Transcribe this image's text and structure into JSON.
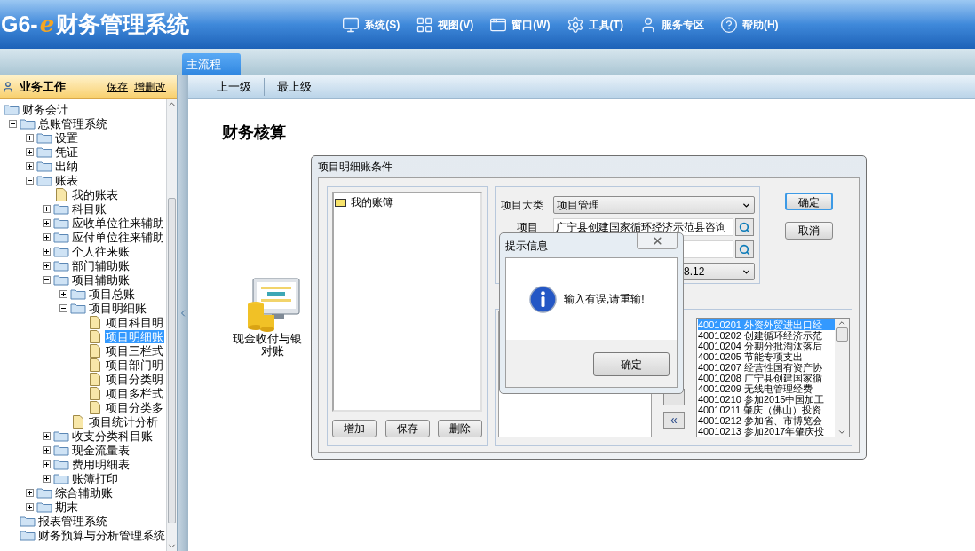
{
  "app": {
    "logo_prefix": "G6-",
    "logo_e": "e",
    "logo_title": "财务管理系统"
  },
  "menu": [
    {
      "kind": "monitor",
      "label": "系统(S)"
    },
    {
      "kind": "grid",
      "label": "视图(V)"
    },
    {
      "kind": "window",
      "label": "窗口(W)"
    },
    {
      "kind": "gear",
      "label": "工具(T)"
    },
    {
      "kind": "user",
      "label": "服务专区"
    },
    {
      "kind": "help",
      "label": "帮助(H)"
    }
  ],
  "tabs": [
    {
      "label": "主流程",
      "selected": true
    }
  ],
  "sidebar": {
    "title": "业务工作",
    "links": [
      "保存",
      "增删改"
    ],
    "tree": [
      {
        "label": "财务会计",
        "kind": "folder",
        "selected": false,
        "children": [
          {
            "label": "总账管理系统",
            "kind": "folder",
            "expanded": true,
            "selected": false,
            "children": [
              {
                "label": "设置",
                "kind": "folder",
                "expanded": false,
                "selected": false
              },
              {
                "label": "凭证",
                "kind": "folder",
                "expanded": false,
                "selected": false
              },
              {
                "label": "出纳",
                "kind": "folder",
                "expanded": false,
                "selected": false
              },
              {
                "label": "账表",
                "kind": "folder",
                "expanded": true,
                "selected": false,
                "children": [
                  {
                    "label": "我的账表",
                    "kind": "doc",
                    "selected": false
                  },
                  {
                    "label": "科目账",
                    "kind": "folder",
                    "expanded": false,
                    "selected": false
                  },
                  {
                    "label": "应收单位往来辅助",
                    "kind": "folder",
                    "expanded": false,
                    "selected": false
                  },
                  {
                    "label": "应付单位往来辅助",
                    "kind": "folder",
                    "expanded": false,
                    "selected": false
                  },
                  {
                    "label": "个人往来账",
                    "kind": "folder",
                    "expanded": false,
                    "selected": false
                  },
                  {
                    "label": "部门辅助账",
                    "kind": "folder",
                    "expanded": false,
                    "selected": false
                  },
                  {
                    "label": "项目辅助账",
                    "kind": "folder",
                    "expanded": true,
                    "selected": false,
                    "children": [
                      {
                        "label": "项目总账",
                        "kind": "folder",
                        "expanded": false,
                        "selected": false
                      },
                      {
                        "label": "项目明细账",
                        "kind": "folder",
                        "expanded": true,
                        "selected": false,
                        "children": [
                          {
                            "label": "项目科目明",
                            "kind": "doc",
                            "selected": false
                          },
                          {
                            "label": "项目明细账",
                            "kind": "doc",
                            "selected": true
                          },
                          {
                            "label": "项目三栏式",
                            "kind": "doc",
                            "selected": false
                          },
                          {
                            "label": "项目部门明",
                            "kind": "doc",
                            "selected": false
                          },
                          {
                            "label": "项目分类明",
                            "kind": "doc",
                            "selected": false
                          },
                          {
                            "label": "项目多栏式",
                            "kind": "doc",
                            "selected": false
                          },
                          {
                            "label": "项目分类多",
                            "kind": "doc",
                            "selected": false
                          }
                        ]
                      },
                      {
                        "label": "项目统计分析",
                        "kind": "doc",
                        "selected": false
                      }
                    ]
                  },
                  {
                    "label": "收支分类科目账",
                    "kind": "folder",
                    "expanded": false,
                    "selected": false
                  },
                  {
                    "label": "现金流量表",
                    "kind": "folder",
                    "expanded": false,
                    "selected": false
                  },
                  {
                    "label": "费用明细表",
                    "kind": "folder",
                    "expanded": false,
                    "selected": false
                  },
                  {
                    "label": "账簿打印",
                    "kind": "folder",
                    "expanded": false,
                    "selected": false
                  }
                ]
              },
              {
                "label": "综合辅助账",
                "kind": "folder",
                "expanded": false,
                "selected": false
              },
              {
                "label": "期末",
                "kind": "folder",
                "expanded": false,
                "selected": false
              }
            ]
          },
          {
            "label": "报表管理系统",
            "kind": "folder",
            "selected": false
          },
          {
            "label": "财务预算与分析管理系统",
            "kind": "folder",
            "selected": false
          }
        ]
      }
    ]
  },
  "toolbar": [
    "上一级",
    "最上级"
  ],
  "page_title": "财务核算",
  "flow_node": {
    "label_line_1": "现金收付与银",
    "label_line_2": "对账"
  },
  "condition_dialog": {
    "title": "项目明细账条件",
    "books": [
      {
        "label": "我的账簿",
        "selected": false
      }
    ],
    "book_buttons": [
      "增加",
      "保存",
      "删除"
    ],
    "category_label": "项目大类",
    "category_value": "项目管理",
    "project_label": "项目",
    "project_value": "广宁县创建国家循环经济示范县咨询",
    "period_value": "8.12",
    "buttons": [
      {
        "label": "确定",
        "focused": true
      },
      {
        "label": "取消",
        "focused": false
      }
    ],
    "move_button": "«",
    "projects": [
      {
        "code": "40010201",
        "name": "外资外贸进出口经",
        "selected": true
      },
      {
        "code": "40010202",
        "name": "创建循环经济示范",
        "selected": false
      },
      {
        "code": "40010204",
        "name": "分期分批淘汰落后",
        "selected": false
      },
      {
        "code": "40010205",
        "name": "节能专项支出",
        "selected": false
      },
      {
        "code": "40010207",
        "name": "经营性国有资产协",
        "selected": false
      },
      {
        "code": "40010208",
        "name": "广宁县创建国家循",
        "selected": false
      },
      {
        "code": "40010209",
        "name": "无线电管理经费",
        "selected": false
      },
      {
        "code": "40010210",
        "name": "参加2015中国加工",
        "selected": false
      },
      {
        "code": "40010211",
        "name": "肇庆（佛山）投资",
        "selected": false
      },
      {
        "code": "40010212",
        "name": "参加省、市博览会",
        "selected": false
      },
      {
        "code": "40010213",
        "name": "参加2017年肇庆投",
        "selected": false
      }
    ]
  },
  "message_box": {
    "title": "提示信息",
    "message": "输入有误,请重输!",
    "button": "确定"
  }
}
